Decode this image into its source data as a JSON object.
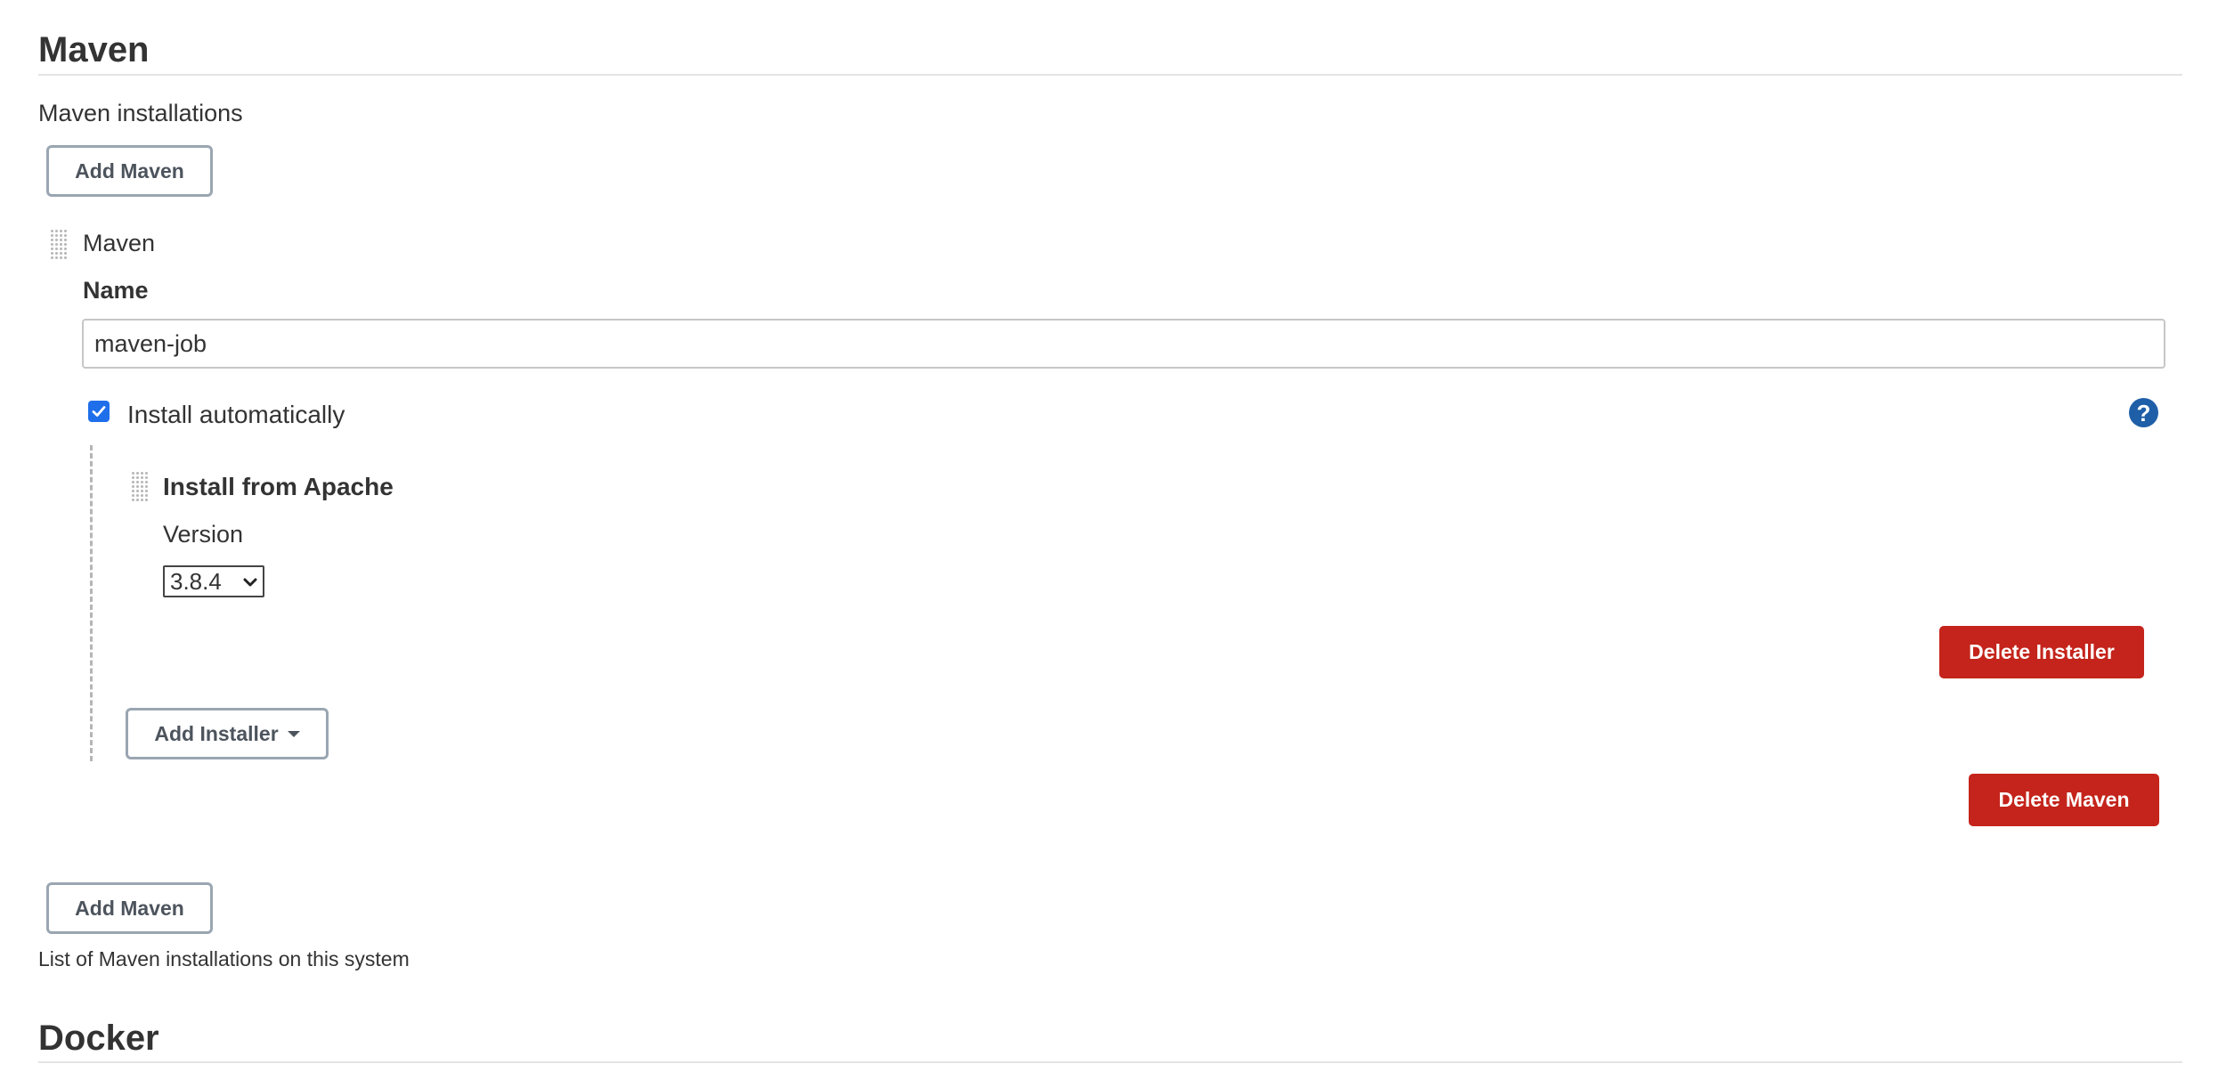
{
  "maven_section": {
    "title": "Maven",
    "installations_label": "Maven installations",
    "add_button_label": "Add Maven",
    "help_text": "List of Maven installations on this system"
  },
  "installation": {
    "header": "Maven",
    "name_label": "Name",
    "name_value": "maven-job",
    "install_auto_label": "Install automatically",
    "install_auto_checked": true,
    "installer": {
      "title": "Install from Apache",
      "version_label": "Version",
      "version_value": "3.8.4",
      "delete_label": "Delete Installer"
    },
    "add_installer_label": "Add Installer",
    "delete_label": "Delete Maven"
  },
  "docker_section": {
    "title": "Docker"
  },
  "icons": {
    "help": "help-icon",
    "drag": "drag-handle-icon",
    "check": "checkmark-icon",
    "dropdown": "chevron-down-icon",
    "caret": "caret-down-icon"
  },
  "colors": {
    "primary": "#1f6feb",
    "help": "#1f5fa8",
    "danger": "#c4241b",
    "outline_border": "#9aa6b2"
  }
}
